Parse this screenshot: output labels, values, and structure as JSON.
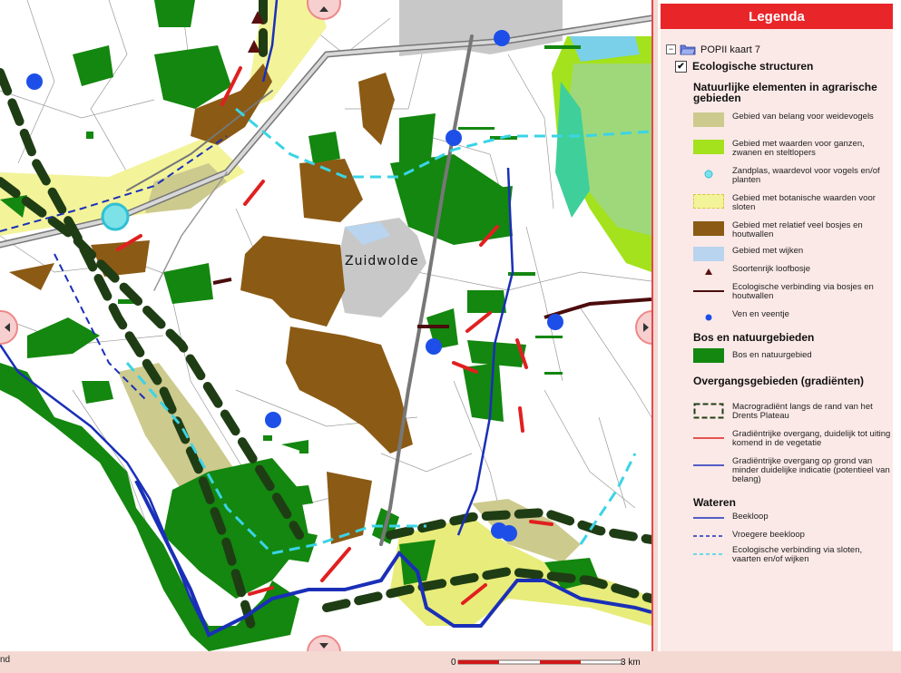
{
  "map": {
    "place_label": "Zuidwolde",
    "status_text": "nd",
    "scale_start": "0",
    "scale_end": "3 km"
  },
  "legend": {
    "title": "Legenda",
    "tree_root": "POPII kaart 7",
    "checkbox_label": "Ecologische structuren",
    "checkbox_checked": true,
    "sections": [
      {
        "heading": "Natuurlijke elementen in agrarische gebieden",
        "items": [
          {
            "label": "Gebied van belang voor weidevogels",
            "icon": "fill-khaki",
            "color": "#cdca8e"
          },
          {
            "label": "Gebied met waarden voor ganzen, zwanen en steltlopers",
            "icon": "fill-lime",
            "color": "#a3e21c"
          },
          {
            "label": "Zandplas, waardevol voor vogels en/of planten",
            "icon": "cyan-dot",
            "color": "#7de1e8"
          },
          {
            "label": "Gebied met botanische waarden voor sloten",
            "icon": "fill-yellow-dashed",
            "color": "#f3f39a"
          },
          {
            "label": "Gebied met relatief veel bosjes en houtwallen",
            "icon": "fill-brown",
            "color": "#8b5a14"
          },
          {
            "label": "Gebied met wijken",
            "icon": "fill-lightblue",
            "color": "#b9d4ee"
          },
          {
            "label": "Soortenrijk loofbosje",
            "icon": "triangle",
            "color": "#5a1010"
          },
          {
            "label": "Ecologische verbinding via bosjes en houtwallen",
            "icon": "line-darkred",
            "color": "#4a0c0c"
          },
          {
            "label": "Ven en veentje",
            "icon": "blue-dot",
            "color": "#1d4fe8"
          }
        ]
      },
      {
        "heading": "Bos en natuurgebieden",
        "items": [
          {
            "label": "Bos en natuurgebied",
            "icon": "fill-green",
            "color": "#13870f"
          }
        ]
      },
      {
        "heading": "Overgangsgebieden (gradiënten)",
        "items": [
          {
            "label": "Macrogradiënt langs de rand van het Drents Plateau",
            "icon": "dashed-box",
            "color": "#1f3d14"
          },
          {
            "label": "Gradiëntrijke overgang, duidelijk tot uiting komend in de vegetatie",
            "icon": "line-red",
            "color": "#e02020"
          },
          {
            "label": "Gradiëntrijke overgang op grond van minder duidelijke indicatie (potentieel van belang)",
            "icon": "line-blue",
            "color": "#1a2fb8"
          }
        ]
      },
      {
        "heading": "Wateren",
        "items": [
          {
            "label": "Beekloop",
            "icon": "line-navy",
            "color": "#1a2fb8"
          },
          {
            "label": "Vroegere beekloop",
            "icon": "dashed-navy",
            "color": "#1a2fb8"
          },
          {
            "label": "Ecologische verbinding via sloten, vaarten en/of wijken",
            "icon": "dashed-cyan",
            "color": "#3ad4e6"
          }
        ]
      }
    ]
  },
  "colors": {
    "accent": "#e8262a",
    "forest": "#13870f",
    "meadow": "#cdca8e",
    "brown": "#8b5a14",
    "urban": "#c8c8c8",
    "stream": "#1a2fb8"
  }
}
